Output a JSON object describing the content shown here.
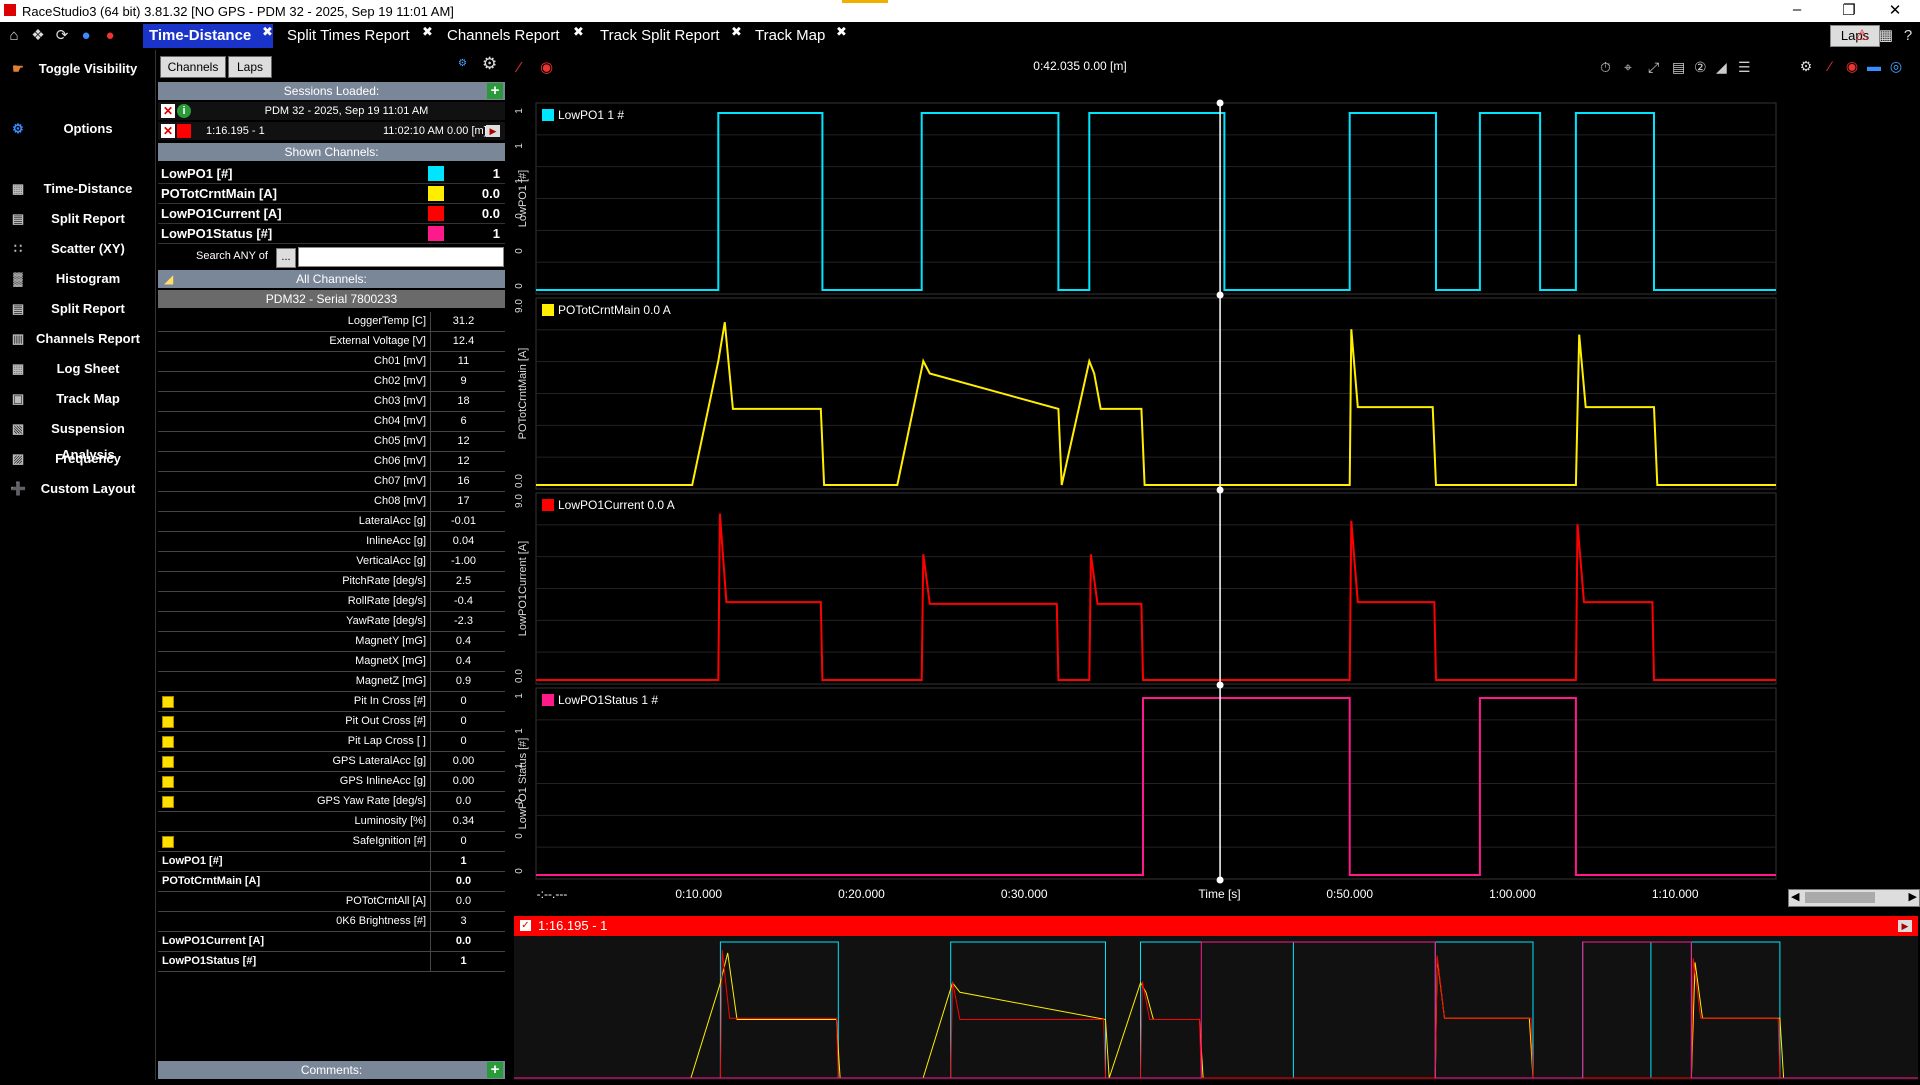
{
  "window": {
    "title": "RaceStudio3 (64 bit) 3.81.32 [NO GPS - PDM 32 - 2025, Sep 19 11:01 AM]"
  },
  "tabs": [
    {
      "label": "Time-Distance",
      "active": true
    },
    {
      "label": "Split Times Report"
    },
    {
      "label": "Channels Report"
    },
    {
      "label": "Track Split Report"
    },
    {
      "label": "Track Map"
    }
  ],
  "laps_button": "Laps",
  "sidebar": {
    "items": [
      {
        "label": "Toggle Visibility",
        "icon": "hand-icon"
      },
      {
        "label": "Options",
        "icon": "gears-icon"
      },
      {
        "label": "Time-Distance",
        "icon": "time-distance-icon"
      },
      {
        "label": "Split Report",
        "icon": "split-report-icon"
      },
      {
        "label": "Scatter (XY)",
        "icon": "scatter-icon"
      },
      {
        "label": "Histogram",
        "icon": "histogram-icon"
      },
      {
        "label": "Split Report",
        "icon": "split-report-icon"
      },
      {
        "label": "Channels Report",
        "icon": "channels-report-icon"
      },
      {
        "label": "Log Sheet",
        "icon": "log-sheet-icon"
      },
      {
        "label": "Track Map",
        "icon": "track-map-icon"
      },
      {
        "label": "Suspension Analysis",
        "icon": "suspension-icon"
      },
      {
        "label": "Frequency",
        "icon": "frequency-icon"
      },
      {
        "label": "Custom Layout",
        "icon": "custom-layout-icon"
      }
    ]
  },
  "panel": {
    "channels_btn": "Channels",
    "laps_btn": "Laps",
    "sessions_loaded": "Sessions Loaded:",
    "session_title": "PDM 32 - 2025, Sep 19 11:01 AM",
    "session_lap": "1:16.195 - 1",
    "session_time": "11:02:10 AM 0.00 [m]",
    "shown_channels_header": "Shown Channels:",
    "shown": [
      {
        "name": "LowPO1 [#]",
        "value": "1",
        "color": "#00e5ff"
      },
      {
        "name": "POTotCrntMain [A]",
        "value": "0.0",
        "color": "#ffee00"
      },
      {
        "name": "LowPO1Current [A]",
        "value": "0.0",
        "color": "#ff0000"
      },
      {
        "name": "LowPO1Status [#]",
        "value": "1",
        "color": "#ff1a8c"
      }
    ],
    "search_label": "Search ANY of",
    "search_btn": "...",
    "all_channels_header": "All Channels:",
    "device_header": "PDM32 - Serial 7800233",
    "rows": [
      {
        "name": "LoggerTemp [C]",
        "value": "31.2"
      },
      {
        "name": "External Voltage [V]",
        "value": "12.4"
      },
      {
        "name": "Ch01 [mV]",
        "value": "11"
      },
      {
        "name": "Ch02 [mV]",
        "value": "9"
      },
      {
        "name": "Ch03 [mV]",
        "value": "18"
      },
      {
        "name": "Ch04 [mV]",
        "value": "6"
      },
      {
        "name": "Ch05 [mV]",
        "value": "12"
      },
      {
        "name": "Ch06 [mV]",
        "value": "12"
      },
      {
        "name": "Ch07 [mV]",
        "value": "16"
      },
      {
        "name": "Ch08 [mV]",
        "value": "17"
      },
      {
        "name": "LateralAcc [g]",
        "value": "-0.01"
      },
      {
        "name": "InlineAcc [g]",
        "value": "0.04"
      },
      {
        "name": "VerticalAcc [g]",
        "value": "-1.00"
      },
      {
        "name": "PitchRate [deg/s]",
        "value": "2.5"
      },
      {
        "name": "RollRate [deg/s]",
        "value": "-0.4"
      },
      {
        "name": "YawRate [deg/s]",
        "value": "-2.3"
      },
      {
        "name": "MagnetY [mG]",
        "value": "0.4"
      },
      {
        "name": "MagnetX [mG]",
        "value": "0.4"
      },
      {
        "name": "MagnetZ [mG]",
        "value": "0.9"
      },
      {
        "name": "Pit In Cross [#]",
        "value": "0",
        "flag": true
      },
      {
        "name": "Pit Out Cross [#]",
        "value": "0",
        "flag": true
      },
      {
        "name": "Pit Lap Cross [ ]",
        "value": "0",
        "flag": true
      },
      {
        "name": "GPS LateralAcc [g]",
        "value": "0.00",
        "flag": true
      },
      {
        "name": "GPS InlineAcc [g]",
        "value": "0.00",
        "flag": true
      },
      {
        "name": "GPS Yaw Rate [deg/s]",
        "value": "0.0",
        "flag": true
      },
      {
        "name": "Luminosity [%]",
        "value": "0.34"
      },
      {
        "name": "SafeIgnition [#]",
        "value": "0",
        "flag": true
      },
      {
        "name": "LowPO1 [#]",
        "value": "1",
        "bold": true
      },
      {
        "name": "POTotCrntMain [A]",
        "value": "0.0",
        "bold": true
      },
      {
        "name": "POTotCrntAll [A]",
        "value": "0.0"
      },
      {
        "name": "0K6 Brightness [#]",
        "value": "3"
      },
      {
        "name": "LowPO1Current [A]",
        "value": "0.0",
        "bold": true
      },
      {
        "name": "LowPO1Status [#]",
        "value": "1",
        "bold": true
      }
    ],
    "comments_header": "Comments:"
  },
  "cursor_readout": "0:42.035 0.00 [m]",
  "chart_data": {
    "type": "line",
    "xlabel": "Time [s]",
    "x_ticks": [
      "-:--.---",
      "0:10.000",
      "0:20.000",
      "0:30.000",
      "Time [s]",
      "0:50.000",
      "1:00.000",
      "1:10.000"
    ],
    "xlim": [
      0,
      76.195
    ],
    "cursor_x": 42.035,
    "series": [
      {
        "name": "LowPO1",
        "legend": "LowPO1  1  #",
        "ylabel": "LowPO1 [#]",
        "color": "#00e5ff",
        "ylim": [
          0,
          1
        ],
        "y_ticks": [
          "1",
          "1",
          "1",
          "0",
          "0",
          "0"
        ],
        "x": [
          0,
          11.2,
          11.2,
          17.6,
          17.6,
          23.7,
          23.7,
          32.1,
          32.1,
          34.0,
          34.0,
          42.3,
          42.3,
          50.0,
          50.0,
          55.3,
          55.3,
          58.0,
          58.0,
          61.7,
          61.7,
          63.9,
          63.9,
          68.7,
          68.7,
          76.195
        ],
        "y": [
          0,
          0,
          1,
          1,
          0,
          0,
          1,
          1,
          0,
          0,
          1,
          1,
          0,
          0,
          1,
          1,
          0,
          0,
          1,
          1,
          0,
          0,
          1,
          1,
          0,
          0
        ]
      },
      {
        "name": "POTotCrntMain",
        "legend": "POTotCrntMain  0.0  A",
        "ylabel": "POTotCrntMain [A]",
        "color": "#ffee00",
        "ylim": [
          0,
          10
        ],
        "y_ticks": [
          "9.0",
          "",
          "",
          "",
          "0.0"
        ],
        "x": [
          0,
          9.6,
          11.2,
          11.6,
          12.1,
          17.5,
          17.7,
          22.2,
          23.8,
          24.2,
          32.1,
          32.3,
          34.0,
          34.3,
          34.7,
          37.2,
          37.4,
          50.0,
          50.1,
          50.5,
          55.1,
          55.3,
          63.9,
          64.1,
          64.5,
          68.7,
          68.9,
          76.195
        ],
        "y": [
          0,
          0,
          7.0,
          9.2,
          4.3,
          4.3,
          0,
          0,
          7.0,
          6.3,
          4.3,
          0,
          7.0,
          6.3,
          4.3,
          4.3,
          0,
          0,
          8.8,
          4.4,
          4.4,
          0,
          0,
          8.5,
          4.4,
          4.4,
          0,
          0
        ]
      },
      {
        "name": "LowPO1Current",
        "legend": "LowPO1Current  0.0  A",
        "ylabel": "LowPO1Current [A]",
        "color": "#ff0000",
        "ylim": [
          0,
          10
        ],
        "y_ticks": [
          "9.0",
          "",
          "",
          "",
          "0.0"
        ],
        "x": [
          0,
          11.2,
          11.3,
          11.7,
          17.5,
          17.6,
          23.7,
          23.8,
          24.2,
          32.0,
          32.1,
          34.0,
          34.1,
          34.5,
          37.2,
          37.3,
          50.0,
          50.1,
          50.5,
          55.2,
          55.3,
          63.9,
          64.0,
          64.4,
          68.6,
          68.7,
          76.195
        ],
        "y": [
          0,
          0,
          9.4,
          4.4,
          4.4,
          0,
          0,
          7.1,
          4.3,
          4.3,
          0,
          0,
          7.1,
          4.3,
          4.3,
          0,
          0,
          9.0,
          4.4,
          4.4,
          0,
          0,
          8.8,
          4.4,
          4.4,
          0,
          0
        ]
      },
      {
        "name": "LowPO1Status",
        "legend": "LowPO1Status  1  #",
        "ylabel": "LowPO1 Status [#]",
        "color": "#ff1a8c",
        "ylim": [
          0,
          1
        ],
        "y_ticks": [
          "1",
          "1",
          "1",
          "0",
          "0",
          "0"
        ],
        "x": [
          0,
          37.3,
          37.3,
          50.0,
          50.0,
          58.0,
          58.0,
          63.9,
          63.9,
          76.195
        ],
        "y": [
          0,
          0,
          1,
          1,
          0,
          0,
          1,
          1,
          0,
          0
        ]
      }
    ]
  },
  "overview": {
    "label": "1:16.195 - 1"
  }
}
